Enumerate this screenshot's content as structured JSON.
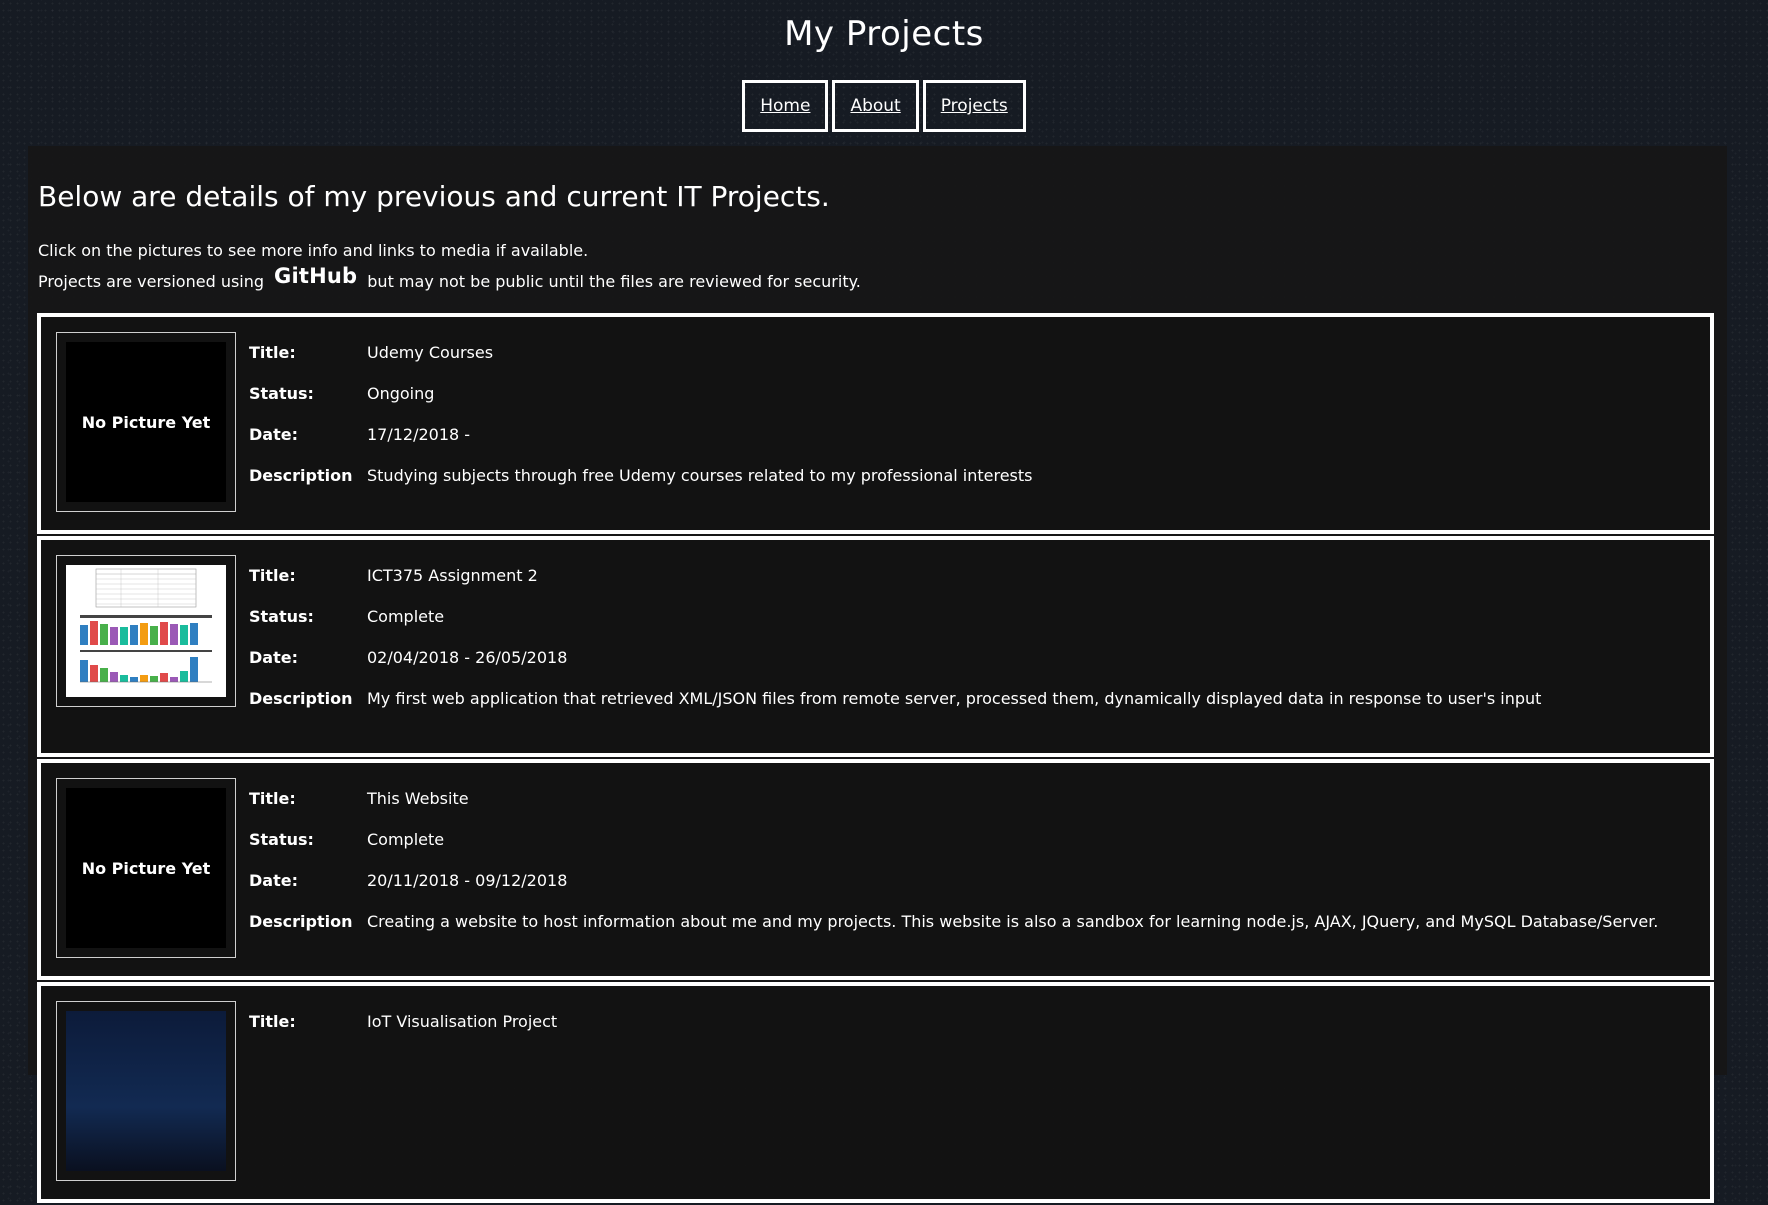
{
  "header": {
    "title": "My Projects"
  },
  "nav": {
    "items": [
      {
        "label": "Home"
      },
      {
        "label": "About"
      },
      {
        "label": "Projects"
      }
    ]
  },
  "intro": {
    "heading": "Below are details of my previous and current IT Projects.",
    "line1": "Click on the pictures to see more info and links to media if available.",
    "line2_before": "Projects are versioned using",
    "github_logo": "GitHub",
    "line2_after": "but may not be public until the files are reviewed for security."
  },
  "field_labels": {
    "title": "Title:",
    "status": "Status:",
    "date": "Date:",
    "description": "Description"
  },
  "projects": [
    {
      "thumb_text": "No Picture Yet",
      "title": "Udemy Courses",
      "status": "Ongoing",
      "date": "17/12/2018 -",
      "description": "Studying subjects through free Udemy courses related to my professional interests"
    },
    {
      "thumb_text": "",
      "title": "ICT375 Assignment 2",
      "status": "Complete",
      "date": "02/04/2018 - 26/05/2018",
      "description": "My first web application that retrieved XML/JSON files from remote server, processed them, dynamically displayed data in response to user's input"
    },
    {
      "thumb_text": "No Picture Yet",
      "title": "This Website",
      "status": "Complete",
      "date": "20/11/2018 - 09/12/2018",
      "description": "Creating a website to host information about me and my projects. This website is also a sandbox for learning node.js, AJAX, JQuery, and MySQL Database/Server."
    },
    {
      "thumb_text": "",
      "title": "IoT Visualisation Project",
      "status": "",
      "date": "",
      "description": ""
    }
  ],
  "colors": {
    "page_background": "#161b23",
    "panel_background": "#161616",
    "text": "#ffffff",
    "border": "#ffffff"
  }
}
